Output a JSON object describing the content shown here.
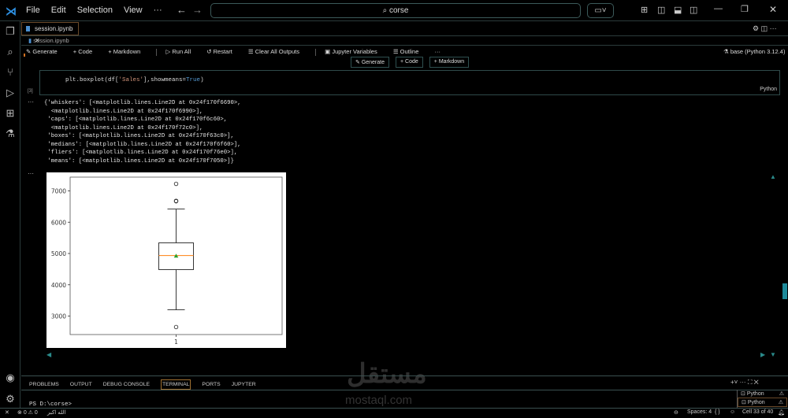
{
  "titlebar": {
    "menu": [
      "File",
      "Edit",
      "Selection",
      "View",
      "···"
    ],
    "search": "corse"
  },
  "tab": {
    "label": "session.ipynb",
    "close": "✕"
  },
  "breadcrumb": "session.ipynb",
  "toolbar": {
    "generate": "Generate",
    "code": "Code",
    "markdown": "Markdown",
    "run_all": "Run All",
    "restart": "Restart",
    "clear": "Clear All Outputs",
    "variables": "Jupyter Variables",
    "outline": "Outline",
    "more": "···",
    "kernel": "base (Python 3.12.4)"
  },
  "insert": {
    "generate": "Generate",
    "code": "Code",
    "markdown": "Markdown"
  },
  "cell": {
    "code_prefix": "plt.boxplot(df[",
    "code_str": "'Sales'",
    "code_mid": "],showmeans=",
    "code_kw": "True",
    "code_end": ")",
    "exec": "[3]",
    "lang": "Python"
  },
  "output": {
    "ellipsis": "···",
    "text": "{'whiskers': [<matplotlib.lines.Line2D at 0x24f170f6690>,\n  <matplotlib.lines.Line2D at 0x24f170f6990>],\n 'caps': [<matplotlib.lines.Line2D at 0x24f170f6c60>,\n  <matplotlib.lines.Line2D at 0x24f170f72c0>],\n 'boxes': [<matplotlib.lines.Line2D at 0x24f170f63c0>],\n 'medians': [<matplotlib.lines.Line2D at 0x24f170f6f60>],\n 'fliers': [<matplotlib.lines.Line2D at 0x24f170f76e0>],\n 'means': [<matplotlib.lines.Line2D at 0x24f170f7050>]}"
  },
  "chart_data": {
    "type": "box",
    "categories": [
      "1"
    ],
    "ylim": [
      2410,
      7440
    ],
    "yticks": [
      3000,
      4000,
      5000,
      6000,
      7000
    ],
    "ytick_labels": [
      "3000",
      "4000",
      "5000",
      "6000",
      "7000"
    ],
    "whisker_low": 3200,
    "q1": 4485,
    "median": 4935,
    "q3": 5340,
    "whisker_high": 6420,
    "mean": 4920,
    "fliers": [
      7225,
      6680,
      6670,
      2650
    ],
    "colors": {
      "median": "#ff7f0e",
      "mean": "#2ca02c"
    }
  },
  "panel": {
    "tabs": [
      "PROBLEMS",
      "OUTPUT",
      "DEBUG CONSOLE",
      "TERMINAL",
      "PORTS",
      "JUPYTER"
    ],
    "active": "TERMINAL",
    "terminal": "PS D:\\corse>",
    "terminals": [
      "Python",
      "Python"
    ]
  },
  "status": {
    "errors": "0",
    "warnings": "0",
    "arabic": "الله اكبر",
    "spaces": "Spaces: 4",
    "braces": "{ }",
    "cell": "Cell 33 of 40"
  },
  "watermark": {
    "arabic": "مستقل",
    "latin": "mostaql.com"
  }
}
